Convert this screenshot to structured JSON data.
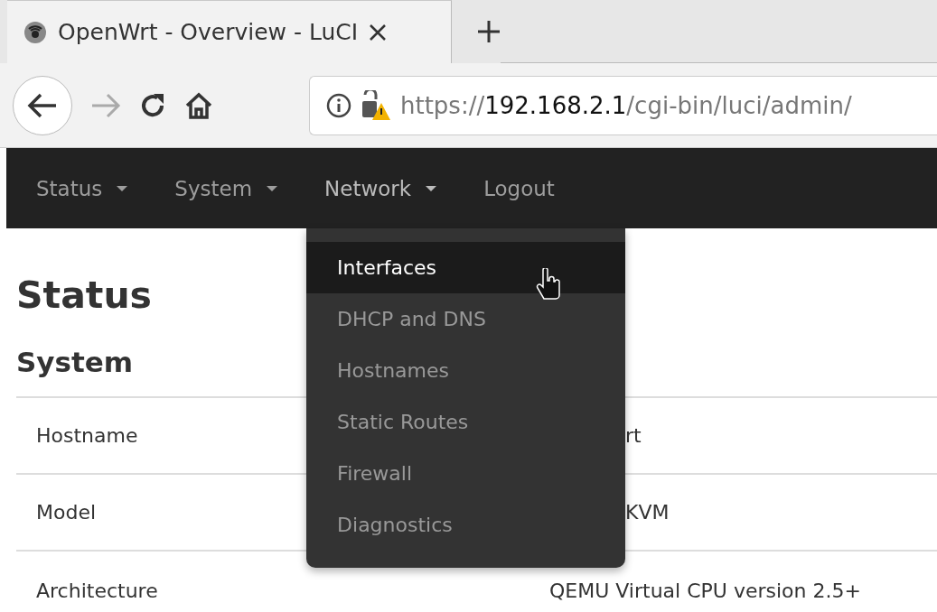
{
  "browser": {
    "tab": {
      "title": "OpenWrt - Overview - LuCI",
      "selected": true
    },
    "forward_disabled": true,
    "url": {
      "scheme": "https://",
      "host": "192.168.2.1",
      "path": "/cgi-bin/luci/admin/"
    }
  },
  "menu": [
    {
      "label": "Status",
      "dropdown": true,
      "open": false
    },
    {
      "label": "System",
      "dropdown": true,
      "open": false
    },
    {
      "label": "Network",
      "dropdown": true,
      "open": true
    },
    {
      "label": "Logout",
      "dropdown": false,
      "open": false
    }
  ],
  "dropdown": {
    "items": [
      {
        "label": "Interfaces",
        "selected": true
      },
      {
        "label": "DHCP and DNS",
        "selected": false
      },
      {
        "label": "Hostnames",
        "selected": false
      },
      {
        "label": "Static Routes",
        "selected": false
      },
      {
        "label": "Firewall",
        "selected": false
      },
      {
        "label": "Diagnostics",
        "selected": false
      }
    ]
  },
  "page": {
    "title": "Status",
    "section": "System",
    "rows": [
      {
        "label": "Hostname",
        "value": "rt",
        "kind": "partial"
      },
      {
        "label": "Model",
        "value": "KVM",
        "kind": "partial"
      },
      {
        "label": "Architecture",
        "value": "QEMU Virtual CPU version 2.5+",
        "kind": "full"
      }
    ]
  }
}
